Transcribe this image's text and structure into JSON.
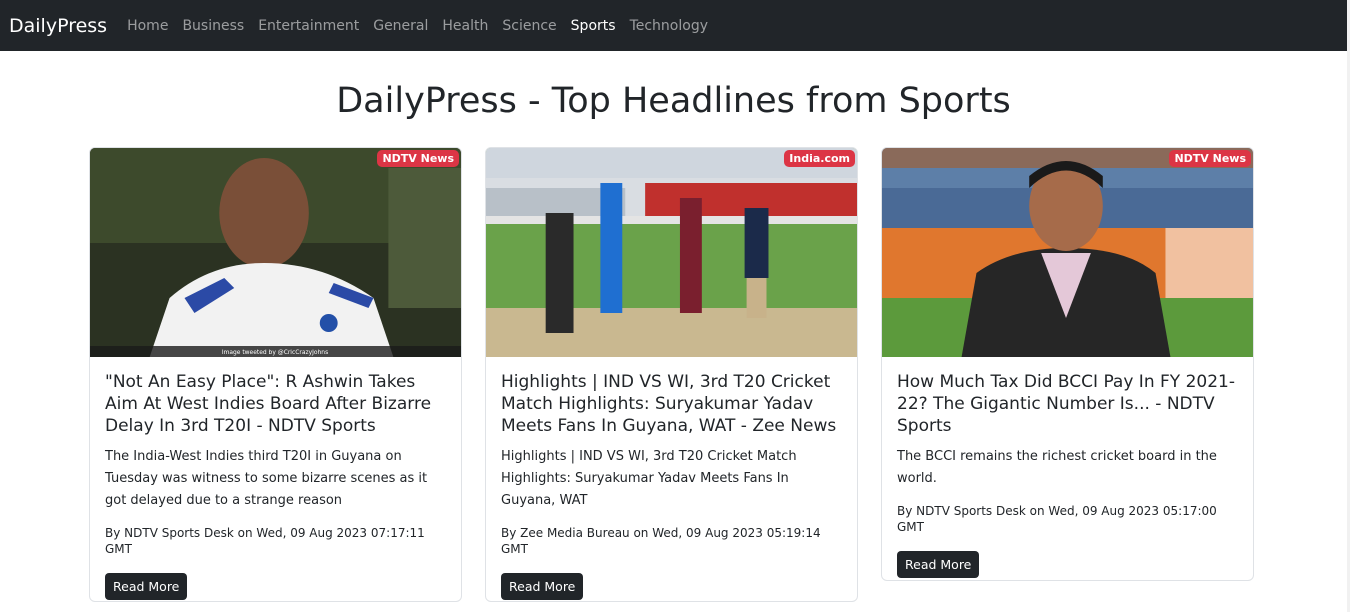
{
  "navbar": {
    "brand": "DailyPress",
    "items": [
      {
        "label": "Home",
        "active": false
      },
      {
        "label": "Business",
        "active": false
      },
      {
        "label": "Entertainment",
        "active": false
      },
      {
        "label": "General",
        "active": false
      },
      {
        "label": "Health",
        "active": false
      },
      {
        "label": "Science",
        "active": false
      },
      {
        "label": "Sports",
        "active": true
      },
      {
        "label": "Technology",
        "active": false
      }
    ]
  },
  "page": {
    "title": "DailyPress - Top Headlines from Sports"
  },
  "cards": [
    {
      "source": "NDTV News",
      "image_caption": "Image tweeted by @CricCrazyJohns",
      "title": "\"Not An Easy Place\": R Ashwin Takes Aim At West Indies Board After Bizarre Delay In 3rd T20I - NDTV Sports",
      "description": "The India-West Indies third T20I in Guyana on Tuesday was witness to some bizarre scenes as it got delayed due to a strange reason",
      "meta": "By NDTV Sports Desk on Wed, 09 Aug 2023 07:17:11 GMT",
      "button": "Read More"
    },
    {
      "source": "India.com",
      "title": "Highlights | IND VS WI, 3rd T20 Cricket Match Highlights: Suryakumar Yadav Meets Fans In Guyana, WAT - Zee News",
      "description": "Highlights | IND VS WI, 3rd T20 Cricket Match Highlights: Suryakumar Yadav Meets Fans In Guyana, WAT",
      "meta": "By Zee Media Bureau on Wed, 09 Aug 2023 05:19:14 GMT",
      "button": "Read More"
    },
    {
      "source": "NDTV News",
      "title": "How Much Tax Did BCCI Pay In FY 2021-22? The Gigantic Number Is... - NDTV Sports",
      "description": "The BCCI remains the richest cricket board in the world.",
      "meta": "By NDTV Sports Desk on Wed, 09 Aug 2023 05:17:00 GMT",
      "button": "Read More"
    }
  ],
  "colors": {
    "navbar_bg": "#212529",
    "badge_bg": "#dc3545",
    "button_bg": "#212529"
  }
}
